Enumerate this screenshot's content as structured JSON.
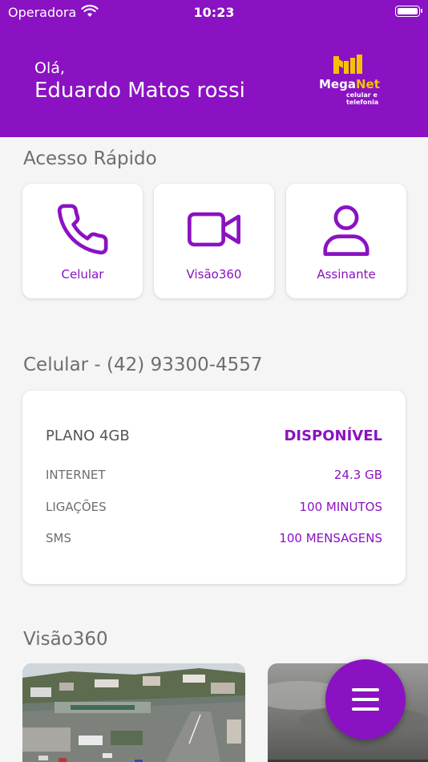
{
  "status_bar": {
    "carrier": "Operadora",
    "time": "10:23"
  },
  "header": {
    "greeting": "Olá,",
    "user_name": "Eduardo Matos rossi",
    "logo": {
      "mega": "Mega",
      "net": "Net",
      "subtitle": "celular e telefonia"
    }
  },
  "quick_access": {
    "title": "Acesso Rápido",
    "items": [
      {
        "label": "Celular",
        "icon": "phone-icon"
      },
      {
        "label": "Visão360",
        "icon": "video-camera-icon"
      },
      {
        "label": "Assinante",
        "icon": "user-icon"
      }
    ]
  },
  "cellular": {
    "title": "Celular - (42) 93300-4557",
    "plan_name": "PLANO 4GB",
    "plan_status": "DISPONÍVEL",
    "rows": [
      {
        "label": "INTERNET",
        "value": "24.3 GB"
      },
      {
        "label": "LIGAÇÕES",
        "value": "100 MINUTOS"
      },
      {
        "label": "SMS",
        "value": "100 MENSAGENS"
      }
    ]
  },
  "visao360": {
    "title": "Visão360"
  },
  "colors": {
    "primary": "#8a12c2",
    "accent": "#f6c100",
    "background": "#f5f5f5",
    "muted_text": "#6e6e6e"
  },
  "fab": {
    "icon": "menu-icon"
  }
}
